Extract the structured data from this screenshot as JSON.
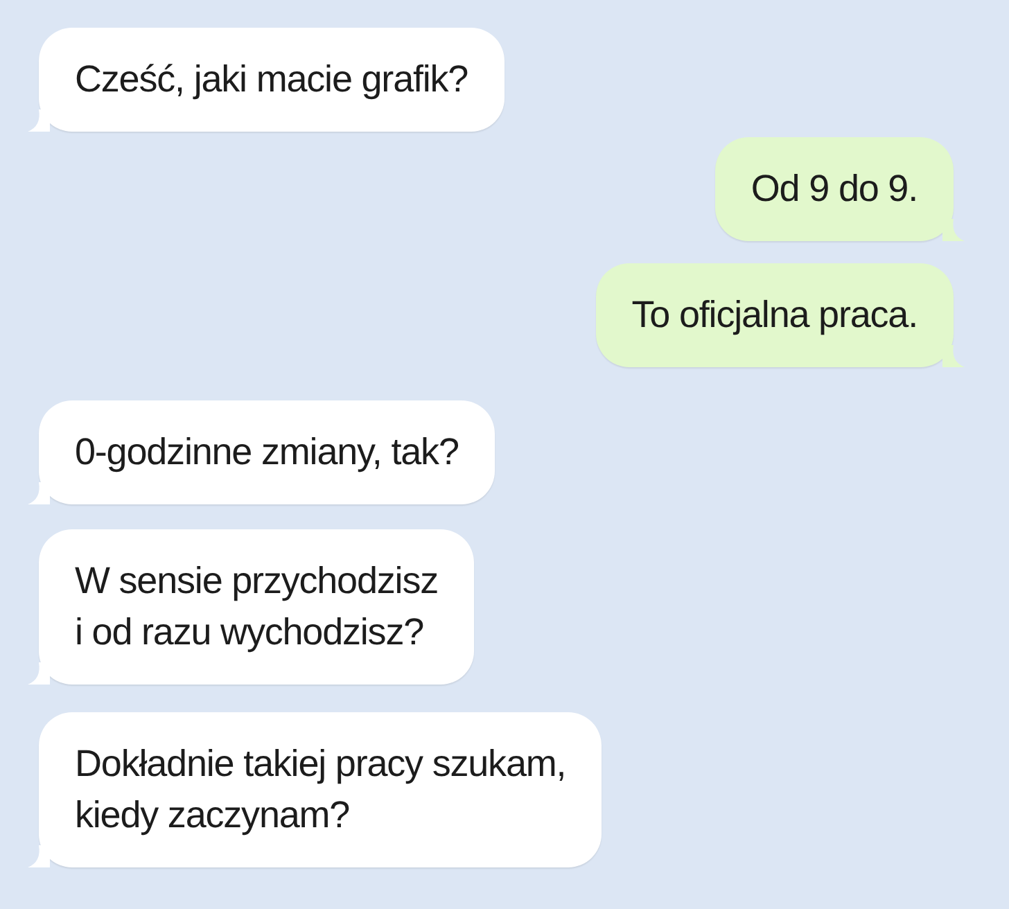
{
  "messages": [
    {
      "kind": "incoming",
      "text": "Cześć, jaki macie grafik?"
    },
    {
      "kind": "outgoing",
      "text": "Od 9 do 9."
    },
    {
      "kind": "outgoing",
      "text": "To oficjalna praca."
    },
    {
      "kind": "incoming",
      "text": "0-godzinne zmiany, tak?"
    },
    {
      "kind": "incoming",
      "text": "W sensie przychodzisz\ni od razu wychodzisz?"
    },
    {
      "kind": "incoming",
      "text": "Dokładnie takiej pracy szukam,\nkiedy zaczynam?"
    }
  ]
}
